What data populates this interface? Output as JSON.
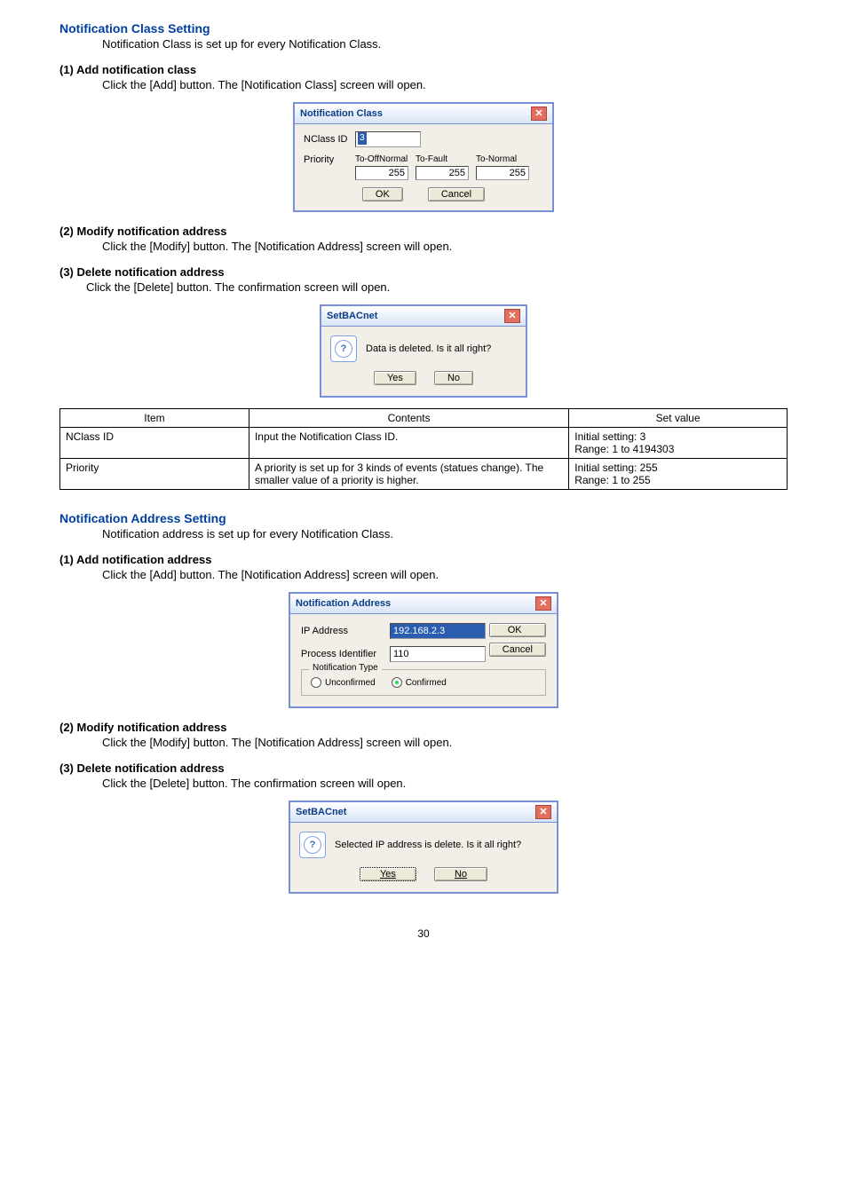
{
  "headings": {
    "nclass_setting": "Notification Class Setting",
    "nclass_setting_desc": "Notification Class is set up for every Notification Class.",
    "add_nclass": "(1) Add notification class",
    "add_nclass_desc": "Click the [Add] button. The [Notification Class] screen will open.",
    "modify_naddr1": "(2) Modify notification address",
    "modify_naddr1_desc": "Click the [Modify] button. The [Notification Address] screen will open.",
    "delete_naddr1": "(3) Delete notification address",
    "delete_naddr1_desc": "Click the [Delete] button. The confirmation screen will open.",
    "naddr_setting": "Notification Address Setting",
    "naddr_setting_desc": "Notification address is set up for every Notification Class.",
    "add_naddr": "(1) Add notification address",
    "add_naddr_desc": "Click the [Add] button. The [Notification Address] screen will open.",
    "modify_naddr2": "(2) Modify notification address",
    "modify_naddr2_desc": "Click the [Modify] button. The [Notification Address] screen will open.",
    "delete_naddr2": "(3) Delete notification address",
    "delete_naddr2_desc": "Click the [Delete] button. The confirmation screen will open."
  },
  "nclass_dialog": {
    "title": "Notification Class",
    "nclass_label": "NClass ID",
    "nclass_value": "3",
    "priority_label": "Priority",
    "cols": [
      "To-OffNormal",
      "To-Fault",
      "To-Normal"
    ],
    "vals": [
      "255",
      "255",
      "255"
    ],
    "ok": "OK",
    "cancel": "Cancel"
  },
  "confirm1": {
    "title": "SetBACnet",
    "msg": "Data is deleted. Is it all right?",
    "yes": "Yes",
    "no": "No"
  },
  "table": {
    "headers": [
      "Item",
      "Contents",
      "Set value"
    ],
    "rows": [
      {
        "item": "NClass ID",
        "contents": "Input the Notification Class ID.",
        "setvalue": "Initial setting: 3\nRange: 1 to 4194303"
      },
      {
        "item": "Priority",
        "contents": "A priority is set up for 3 kinds of events (statues change). The smaller value of a priority is higher.",
        "setvalue": "Initial setting: 255\nRange: 1 to 255"
      }
    ]
  },
  "naddr_dialog": {
    "title": "Notification Address",
    "ip_label": "IP Address",
    "ip_value": "192.168.2.3",
    "pid_label": "Process Identifier",
    "pid_value": "110",
    "group": "Notification Type",
    "unconfirmed": "Unconfirmed",
    "confirmed": "Confirmed",
    "ok": "OK",
    "cancel": "Cancel"
  },
  "confirm2": {
    "title": "SetBACnet",
    "msg": "Selected IP address is delete. Is it all right?",
    "yes": "Yes",
    "no": "No"
  },
  "page": "30"
}
